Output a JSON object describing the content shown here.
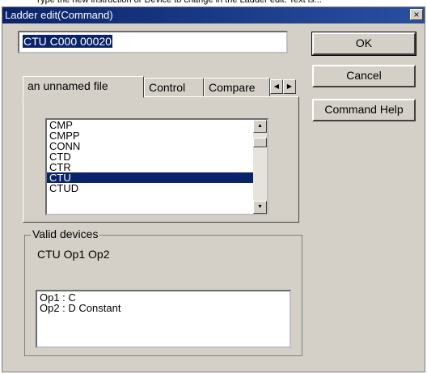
{
  "top_note": "Type the new instruction or Device to change in the Ladder edit. Text is...",
  "window": {
    "title": "Ladder edit(Command)",
    "close_label": "×"
  },
  "command": {
    "value": "CTU C000 00020"
  },
  "buttons": {
    "ok": "OK",
    "cancel": "Cancel",
    "help": "Command Help"
  },
  "tabs": [
    {
      "label": "an unnamed file",
      "active": true
    },
    {
      "label": "Control",
      "active": false
    },
    {
      "label": "Compare",
      "active": false
    }
  ],
  "tab_scroll": {
    "left": "◀",
    "right": "▶"
  },
  "command_list": {
    "items": [
      "CMP",
      "CMPP",
      "CONN",
      "CTD",
      "CTR",
      "CTU",
      "CTUD"
    ],
    "selected": "CTU"
  },
  "scroll_arrows": {
    "up": "▲",
    "down": "▼"
  },
  "valid_devices": {
    "label": "Valid devices",
    "syntax": "CTU Op1 Op2",
    "operands": [
      "Op1 : C",
      "Op2 : D Constant"
    ]
  },
  "colors": {
    "title_bar": "#0a246a",
    "selection": "#0a246a",
    "face": "#d4d0c8"
  }
}
